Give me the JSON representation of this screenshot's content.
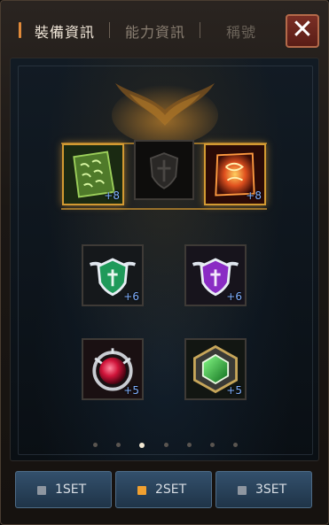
{
  "tabs": {
    "equipment": "裝備資訊",
    "ability": "能力資訊",
    "title": "稱號"
  },
  "close": {
    "icon": "close-x-icon",
    "symbol": "✕"
  },
  "slots": [
    {
      "name": "green-tablet-icon",
      "level": "+8"
    },
    {
      "name": "empty-shield-slot-icon",
      "level": ""
    },
    {
      "name": "red-fire-tablet-icon",
      "level": "+8"
    },
    {
      "name": "green-winged-crest-icon",
      "level": "+6"
    },
    {
      "name": "purple-winged-crest-icon",
      "level": "+6"
    },
    {
      "name": "red-gem-amulet-icon",
      "level": "+5"
    },
    {
      "name": "green-gem-emblem-icon",
      "level": "+5"
    }
  ],
  "pagination": {
    "pages": 8,
    "current": 3
  },
  "sets": [
    {
      "label": "1SET",
      "active": false
    },
    {
      "label": "2SET",
      "active": true
    },
    {
      "label": "3SET",
      "active": false
    }
  ],
  "colors": {
    "accent": "#e08a3a",
    "gold_frame": "#d39a32",
    "level_text": "#7fb0ff",
    "active_set": "#f0a030"
  }
}
